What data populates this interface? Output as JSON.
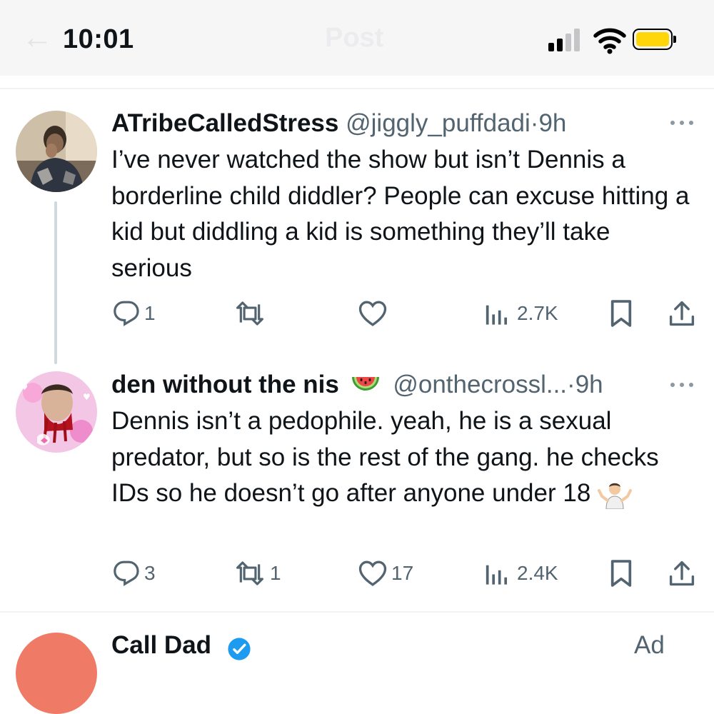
{
  "status_bar": {
    "time": "10:01",
    "header_title": "Post",
    "icons": [
      "signal-icon",
      "wifi-icon",
      "battery-icon"
    ]
  },
  "posts": [
    {
      "display_name": "ATribeCalledStress",
      "handle": "@jiggly_puffdadi",
      "separator": "·",
      "time": "9h",
      "text": "I’ve never watched the show but isn’t Dennis a borderline child diddler? People can excuse hitting a kid but diddling a kid is something they’ll take serious",
      "replies": "1",
      "reposts": "",
      "likes": "",
      "views": "2.7K"
    },
    {
      "display_name": "den without the nis",
      "handle": "@onthecrossl...",
      "separator": "·",
      "time": "9h",
      "text_main": "Dennis isn’t a pedophile. yeah, he is a sexual predator, but so is the rest of the gang. he checks IDs so he doesn’t go after anyone under 18",
      "replies": "3",
      "reposts": "1",
      "likes": "17",
      "views": "2.4K"
    }
  ],
  "next_post": {
    "display_name_partial": "Call Dad",
    "meta_partial": "Ad"
  },
  "colors": {
    "text": "#0f1419",
    "secondary": "#536471",
    "divider": "#eff3f4",
    "thread_line": "#cfd9de",
    "battery": "#ffd60a",
    "verified": "#1d9bf0"
  }
}
